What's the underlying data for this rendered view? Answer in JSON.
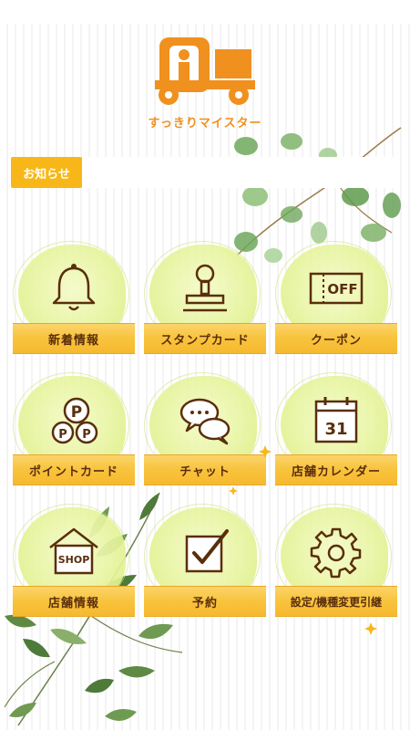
{
  "app": {
    "brand_name": "すっきりマイスター",
    "brand_color": "#f0901e",
    "accent_color": "#f8b718"
  },
  "news": {
    "label": "お知らせ"
  },
  "menu": [
    {
      "label": "新着情報",
      "icon": "bell-icon"
    },
    {
      "label": "スタンプカード",
      "icon": "stamp-icon"
    },
    {
      "label": "クーポン",
      "icon": "coupon-off-icon",
      "icon_text": "OFF"
    },
    {
      "label": "ポイントカード",
      "icon": "points-coins-icon",
      "icon_text": "P"
    },
    {
      "label": "チャット",
      "icon": "chat-bubbles-icon"
    },
    {
      "label": "店舗カレンダー",
      "icon": "calendar-icon",
      "icon_text": "31"
    },
    {
      "label": "店舗情報",
      "icon": "shop-house-icon",
      "icon_text": "SHOP"
    },
    {
      "label": "予約",
      "icon": "checkbox-icon"
    },
    {
      "label": "設定/機種変更引継",
      "icon": "gear-icon"
    }
  ]
}
